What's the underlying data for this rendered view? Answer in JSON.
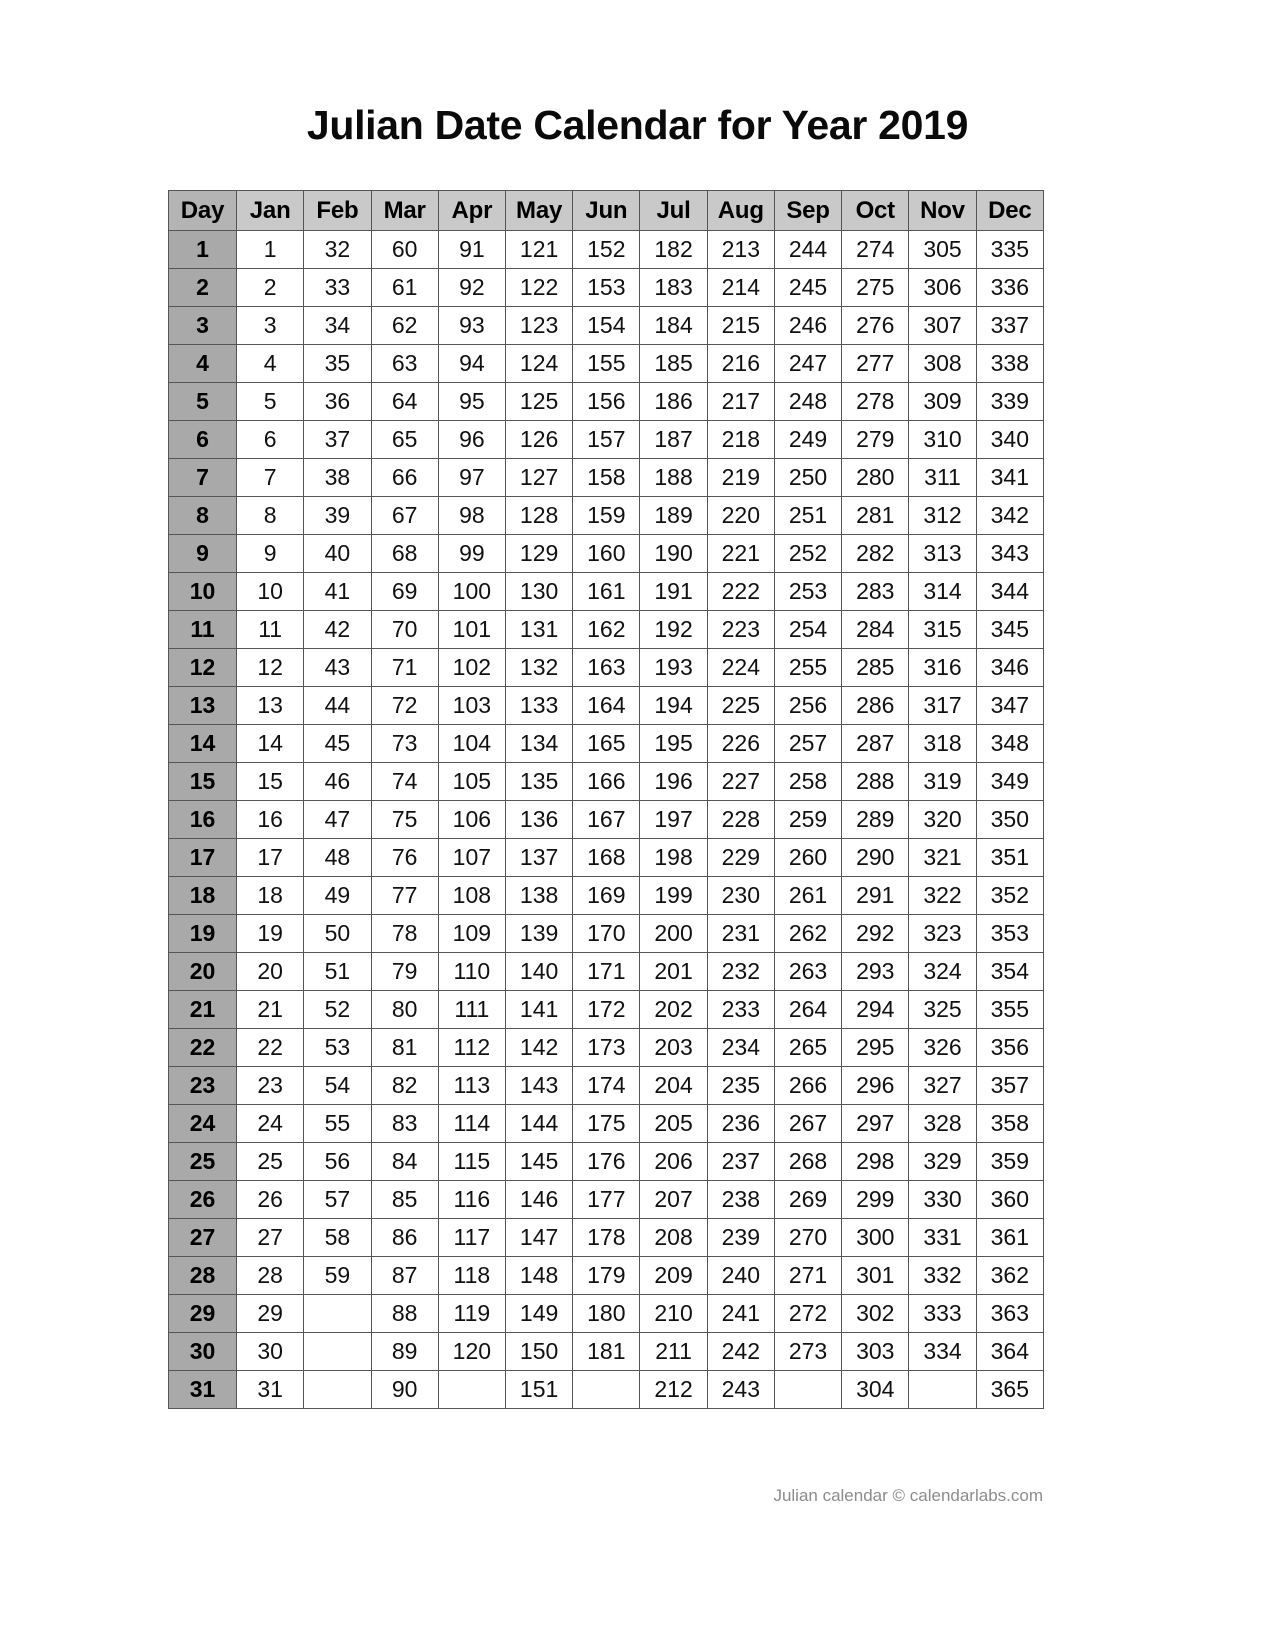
{
  "document": {
    "title": "Julian Date Calendar for Year 2019",
    "year": "2019",
    "footer": "Julian calendar © calendarlabs.com"
  },
  "colors": {
    "header_bg": "#c9c9c9",
    "day_header_bg": "#b4b4b4",
    "day_column_bg": "#a9a9a9",
    "cell_bg": "#ffffff",
    "border": "#555555",
    "text": "#000000",
    "footer_text": "#8c8c8c"
  },
  "table": {
    "columns": [
      "Day",
      "Jan",
      "Feb",
      "Mar",
      "Apr",
      "May",
      "Jun",
      "Jul",
      "Aug",
      "Sep",
      "Oct",
      "Nov",
      "Dec"
    ],
    "day_labels": [
      "1",
      "2",
      "3",
      "4",
      "5",
      "6",
      "7",
      "8",
      "9",
      "10",
      "11",
      "12",
      "13",
      "14",
      "15",
      "16",
      "17",
      "18",
      "19",
      "20",
      "21",
      "22",
      "23",
      "24",
      "25",
      "26",
      "27",
      "28",
      "29",
      "30",
      "31"
    ],
    "rows": [
      [
        "1",
        "1",
        "32",
        "60",
        "91",
        "121",
        "152",
        "182",
        "213",
        "244",
        "274",
        "305",
        "335"
      ],
      [
        "2",
        "2",
        "33",
        "61",
        "92",
        "122",
        "153",
        "183",
        "214",
        "245",
        "275",
        "306",
        "336"
      ],
      [
        "3",
        "3",
        "34",
        "62",
        "93",
        "123",
        "154",
        "184",
        "215",
        "246",
        "276",
        "307",
        "337"
      ],
      [
        "4",
        "4",
        "35",
        "63",
        "94",
        "124",
        "155",
        "185",
        "216",
        "247",
        "277",
        "308",
        "338"
      ],
      [
        "5",
        "5",
        "36",
        "64",
        "95",
        "125",
        "156",
        "186",
        "217",
        "248",
        "278",
        "309",
        "339"
      ],
      [
        "6",
        "6",
        "37",
        "65",
        "96",
        "126",
        "157",
        "187",
        "218",
        "249",
        "279",
        "310",
        "340"
      ],
      [
        "7",
        "7",
        "38",
        "66",
        "97",
        "127",
        "158",
        "188",
        "219",
        "250",
        "280",
        "311",
        "341"
      ],
      [
        "8",
        "8",
        "39",
        "67",
        "98",
        "128",
        "159",
        "189",
        "220",
        "251",
        "281",
        "312",
        "342"
      ],
      [
        "9",
        "9",
        "40",
        "68",
        "99",
        "129",
        "160",
        "190",
        "221",
        "252",
        "282",
        "313",
        "343"
      ],
      [
        "10",
        "10",
        "41",
        "69",
        "100",
        "130",
        "161",
        "191",
        "222",
        "253",
        "283",
        "314",
        "344"
      ],
      [
        "11",
        "11",
        "42",
        "70",
        "101",
        "131",
        "162",
        "192",
        "223",
        "254",
        "284",
        "315",
        "345"
      ],
      [
        "12",
        "12",
        "43",
        "71",
        "102",
        "132",
        "163",
        "193",
        "224",
        "255",
        "285",
        "316",
        "346"
      ],
      [
        "13",
        "13",
        "44",
        "72",
        "103",
        "133",
        "164",
        "194",
        "225",
        "256",
        "286",
        "317",
        "347"
      ],
      [
        "14",
        "14",
        "45",
        "73",
        "104",
        "134",
        "165",
        "195",
        "226",
        "257",
        "287",
        "318",
        "348"
      ],
      [
        "15",
        "15",
        "46",
        "74",
        "105",
        "135",
        "166",
        "196",
        "227",
        "258",
        "288",
        "319",
        "349"
      ],
      [
        "16",
        "16",
        "47",
        "75",
        "106",
        "136",
        "167",
        "197",
        "228",
        "259",
        "289",
        "320",
        "350"
      ],
      [
        "17",
        "17",
        "48",
        "76",
        "107",
        "137",
        "168",
        "198",
        "229",
        "260",
        "290",
        "321",
        "351"
      ],
      [
        "18",
        "18",
        "49",
        "77",
        "108",
        "138",
        "169",
        "199",
        "230",
        "261",
        "291",
        "322",
        "352"
      ],
      [
        "19",
        "19",
        "50",
        "78",
        "109",
        "139",
        "170",
        "200",
        "231",
        "262",
        "292",
        "323",
        "353"
      ],
      [
        "20",
        "20",
        "51",
        "79",
        "110",
        "140",
        "171",
        "201",
        "232",
        "263",
        "293",
        "324",
        "354"
      ],
      [
        "21",
        "21",
        "52",
        "80",
        "111",
        "141",
        "172",
        "202",
        "233",
        "264",
        "294",
        "325",
        "355"
      ],
      [
        "22",
        "22",
        "53",
        "81",
        "112",
        "142",
        "173",
        "203",
        "234",
        "265",
        "295",
        "326",
        "356"
      ],
      [
        "23",
        "23",
        "54",
        "82",
        "113",
        "143",
        "174",
        "204",
        "235",
        "266",
        "296",
        "327",
        "357"
      ],
      [
        "24",
        "24",
        "55",
        "83",
        "114",
        "144",
        "175",
        "205",
        "236",
        "267",
        "297",
        "328",
        "358"
      ],
      [
        "25",
        "25",
        "56",
        "84",
        "115",
        "145",
        "176",
        "206",
        "237",
        "268",
        "298",
        "329",
        "359"
      ],
      [
        "26",
        "26",
        "57",
        "85",
        "116",
        "146",
        "177",
        "207",
        "238",
        "269",
        "299",
        "330",
        "360"
      ],
      [
        "27",
        "27",
        "58",
        "86",
        "117",
        "147",
        "178",
        "208",
        "239",
        "270",
        "300",
        "331",
        "361"
      ],
      [
        "28",
        "28",
        "59",
        "87",
        "118",
        "148",
        "179",
        "209",
        "240",
        "271",
        "301",
        "332",
        "362"
      ],
      [
        "29",
        "29",
        "",
        "88",
        "119",
        "149",
        "180",
        "210",
        "241",
        "272",
        "302",
        "333",
        "363"
      ],
      [
        "30",
        "30",
        "",
        "89",
        "120",
        "150",
        "181",
        "211",
        "242",
        "273",
        "303",
        "334",
        "364"
      ],
      [
        "31",
        "31",
        "",
        "90",
        "",
        "151",
        "",
        "212",
        "243",
        "",
        "304",
        "",
        "365"
      ]
    ]
  }
}
